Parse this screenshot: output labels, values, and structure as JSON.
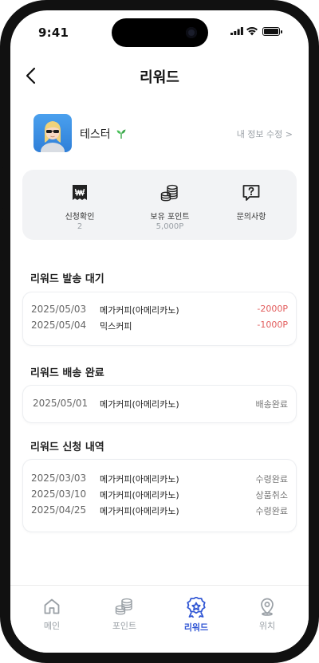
{
  "status": {
    "time": "9:41"
  },
  "header": {
    "title": "리워드"
  },
  "profile": {
    "name": "테스터",
    "edit_label": "내 정보 수정 >"
  },
  "summary": [
    {
      "label": "신청확인",
      "value": "2",
      "icon": "receipt-won-icon"
    },
    {
      "label": "보유 포인트",
      "value": "5,000P",
      "icon": "coins-icon"
    },
    {
      "label": "문의사항",
      "value": "",
      "icon": "question-bubble-icon"
    }
  ],
  "sections": {
    "pending": {
      "title": "리워드 발송 대기",
      "rows": [
        {
          "date": "2025/05/03",
          "item": "메가커피(아메리카노)",
          "amount": "-2000P"
        },
        {
          "date": "2025/05/04",
          "item": "믹스커피",
          "amount": "-1000P"
        }
      ]
    },
    "delivered": {
      "title": "리워드 배송 완료",
      "rows": [
        {
          "date": "2025/05/01",
          "item": "메가커피(아메리카노)",
          "status": "배송완료"
        }
      ]
    },
    "history": {
      "title": "리워드 신청 내역",
      "rows": [
        {
          "date": "2025/03/03",
          "item": "메가커피(아메리카노)",
          "status": "수령완료"
        },
        {
          "date": "2025/03/10",
          "item": "메가커피(아메리카노)",
          "status": "상품취소"
        },
        {
          "date": "2025/04/25",
          "item": "메가커피(아메리카노)",
          "status": "수령완료"
        }
      ]
    }
  },
  "tabs": [
    {
      "label": "메인",
      "icon": "home-icon",
      "active": false
    },
    {
      "label": "포인트",
      "icon": "coins-icon",
      "active": false
    },
    {
      "label": "리워드",
      "icon": "award-badge-icon",
      "active": true
    },
    {
      "label": "위치",
      "icon": "location-pin-icon",
      "active": false
    }
  ],
  "colors": {
    "accent": "#2f55d4",
    "negative": "#e25b5b",
    "panel": "#f2f3f5"
  }
}
